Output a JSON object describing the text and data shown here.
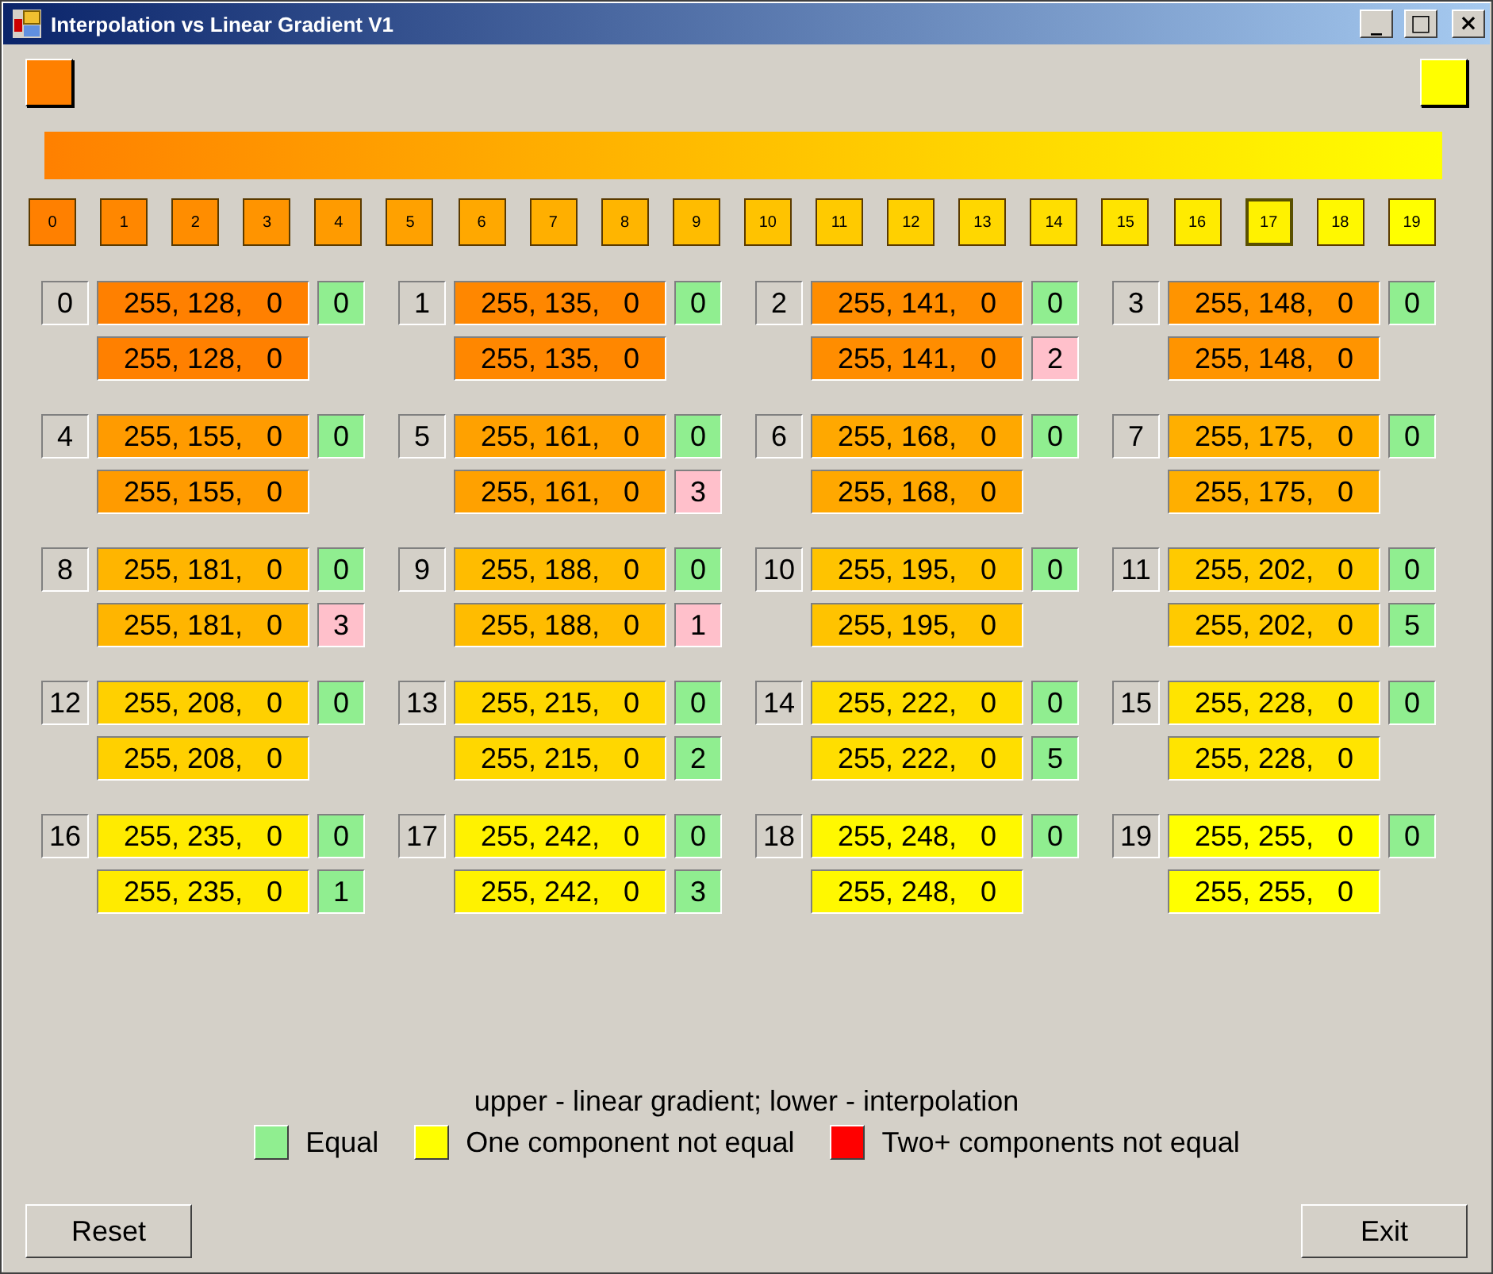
{
  "window": {
    "title": "Interpolation vs Linear Gradient V1",
    "controls": [
      "_",
      "□",
      "×"
    ]
  },
  "start_color": {
    "color": "#ff8000"
  },
  "end_color": {
    "color": "#ffff00"
  },
  "swatches": [
    {
      "label": "0",
      "color": "#ff8000",
      "selected": false
    },
    {
      "label": "1",
      "color": "#ff8700",
      "selected": false
    },
    {
      "label": "2",
      "color": "#ff8d00",
      "selected": false
    },
    {
      "label": "3",
      "color": "#ff9400",
      "selected": false
    },
    {
      "label": "4",
      "color": "#ff9b00",
      "selected": false
    },
    {
      "label": "5",
      "color": "#ffa100",
      "selected": false
    },
    {
      "label": "6",
      "color": "#ffa800",
      "selected": false
    },
    {
      "label": "7",
      "color": "#ffaf00",
      "selected": false
    },
    {
      "label": "8",
      "color": "#ffb500",
      "selected": false
    },
    {
      "label": "9",
      "color": "#ffbc00",
      "selected": false
    },
    {
      "label": "10",
      "color": "#ffc300",
      "selected": false
    },
    {
      "label": "11",
      "color": "#ffca00",
      "selected": false
    },
    {
      "label": "12",
      "color": "#ffd000",
      "selected": false
    },
    {
      "label": "13",
      "color": "#ffd700",
      "selected": false
    },
    {
      "label": "14",
      "color": "#ffde00",
      "selected": false
    },
    {
      "label": "15",
      "color": "#ffe400",
      "selected": false
    },
    {
      "label": "16",
      "color": "#ffeb00",
      "selected": false
    },
    {
      "label": "17",
      "color": "#fff200",
      "selected": true
    },
    {
      "label": "18",
      "color": "#fff800",
      "selected": false
    },
    {
      "label": "19",
      "color": "#ffff00",
      "selected": false
    }
  ],
  "cells": [
    {
      "index": "0",
      "color": "#ff8000",
      "upper": "255, 128,   0",
      "upper_diff": {
        "text": "0",
        "color": "#90ee90"
      },
      "lower": "255, 128,   0"
    },
    {
      "index": "1",
      "color": "#ff8700",
      "upper": "255, 135,   0",
      "upper_diff": {
        "text": "0",
        "color": "#90ee90"
      },
      "lower": "255, 135,   0"
    },
    {
      "index": "2",
      "color": "#ff8d00",
      "upper": "255, 141,   0",
      "upper_diff": {
        "text": "0",
        "color": "#90ee90"
      },
      "lower": "255, 141,   0",
      "lower_diff": {
        "text": "2",
        "color": "#ffc0cb"
      }
    },
    {
      "index": "3",
      "color": "#ff9400",
      "upper": "255, 148,   0",
      "upper_diff": {
        "text": "0",
        "color": "#90ee90"
      },
      "lower": "255, 148,   0"
    },
    {
      "index": "4",
      "color": "#ff9b00",
      "upper": "255, 155,   0",
      "upper_diff": {
        "text": "0",
        "color": "#90ee90"
      },
      "lower": "255, 155,   0"
    },
    {
      "index": "5",
      "color": "#ffa100",
      "upper": "255, 161,   0",
      "upper_diff": {
        "text": "0",
        "color": "#90ee90"
      },
      "lower": "255, 161,   0",
      "lower_diff": {
        "text": "3",
        "color": "#ffc0cb"
      }
    },
    {
      "index": "6",
      "color": "#ffa800",
      "upper": "255, 168,   0",
      "upper_diff": {
        "text": "0",
        "color": "#90ee90"
      },
      "lower": "255, 168,   0"
    },
    {
      "index": "7",
      "color": "#ffaf00",
      "upper": "255, 175,   0",
      "upper_diff": {
        "text": "0",
        "color": "#90ee90"
      },
      "lower": "255, 175,   0"
    },
    {
      "index": "8",
      "color": "#ffb500",
      "upper": "255, 181,   0",
      "upper_diff": {
        "text": "0",
        "color": "#90ee90"
      },
      "lower": "255, 181,   0",
      "lower_diff": {
        "text": "3",
        "color": "#ffc0cb"
      }
    },
    {
      "index": "9",
      "color": "#ffbc00",
      "upper": "255, 188,   0",
      "upper_diff": {
        "text": "0",
        "color": "#90ee90"
      },
      "lower": "255, 188,   0",
      "lower_diff": {
        "text": "1",
        "color": "#ffc0cb"
      }
    },
    {
      "index": "10",
      "color": "#ffc300",
      "upper": "255, 195,   0",
      "upper_diff": {
        "text": "0",
        "color": "#90ee90"
      },
      "lower": "255, 195,   0"
    },
    {
      "index": "11",
      "color": "#ffca00",
      "upper": "255, 202,   0",
      "upper_diff": {
        "text": "0",
        "color": "#90ee90"
      },
      "lower": "255, 202,   0",
      "lower_diff": {
        "text": "5",
        "color": "#90ee90"
      }
    },
    {
      "index": "12",
      "color": "#ffd000",
      "upper": "255, 208,   0",
      "upper_diff": {
        "text": "0",
        "color": "#90ee90"
      },
      "lower": "255, 208,   0"
    },
    {
      "index": "13",
      "color": "#ffd700",
      "upper": "255, 215,   0",
      "upper_diff": {
        "text": "0",
        "color": "#90ee90"
      },
      "lower": "255, 215,   0",
      "lower_diff": {
        "text": "2",
        "color": "#90ee90"
      }
    },
    {
      "index": "14",
      "color": "#ffde00",
      "upper": "255, 222,   0",
      "upper_diff": {
        "text": "0",
        "color": "#90ee90"
      },
      "lower": "255, 222,   0",
      "lower_diff": {
        "text": "5",
        "color": "#90ee90"
      }
    },
    {
      "index": "15",
      "color": "#ffe400",
      "upper": "255, 228,   0",
      "upper_diff": {
        "text": "0",
        "color": "#90ee90"
      },
      "lower": "255, 228,   0"
    },
    {
      "index": "16",
      "color": "#ffeb00",
      "upper": "255, 235,   0",
      "upper_diff": {
        "text": "0",
        "color": "#90ee90"
      },
      "lower": "255, 235,   0",
      "lower_diff": {
        "text": "1",
        "color": "#90ee90"
      }
    },
    {
      "index": "17",
      "color": "#fff200",
      "upper": "255, 242,   0",
      "upper_diff": {
        "text": "0",
        "color": "#90ee90"
      },
      "lower": "255, 242,   0",
      "lower_diff": {
        "text": "3",
        "color": "#90ee90"
      }
    },
    {
      "index": "18",
      "color": "#fff800",
      "upper": "255, 248,   0",
      "upper_diff": {
        "text": "0",
        "color": "#90ee90"
      },
      "lower": "255, 248,   0"
    },
    {
      "index": "19",
      "color": "#ffff00",
      "upper": "255, 255,   0",
      "upper_diff": {
        "text": "0",
        "color": "#90ee90"
      },
      "lower": "255, 255,   0"
    }
  ],
  "caption": "upper - linear gradient; lower - interpolation",
  "legend": [
    {
      "label": "Equal",
      "color": "#90ee90"
    },
    {
      "label": "One component not equal",
      "color": "#ffff00"
    },
    {
      "label": "Two+ components not equal",
      "color": "#ff0000"
    }
  ],
  "buttons": [
    "Reset",
    "Exit"
  ]
}
